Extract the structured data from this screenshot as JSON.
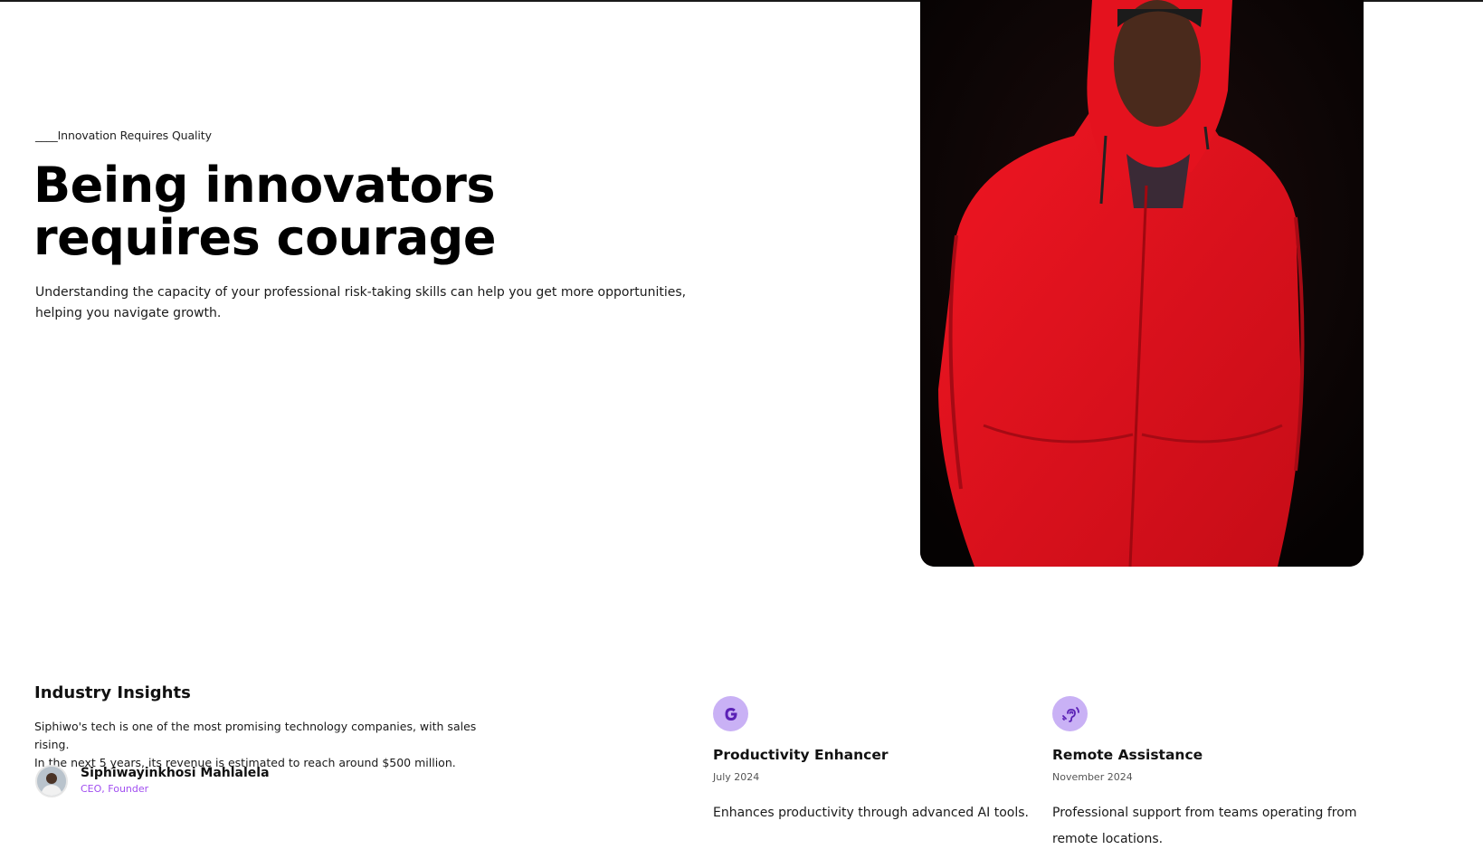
{
  "hero": {
    "eyebrow": "____Innovation Requires Quality",
    "headline": "Being innovators requires courage",
    "lead": "Understanding the capacity of your professional risk-taking skills can help you get more opportunities, helping you navigate growth."
  },
  "insights": {
    "title": "Industry Insights",
    "text_line1": "Siphiwo's tech is one of the most promising technology companies, with sales rising.",
    "text_line2": "In the next 5 years, its revenue is estimated to reach around $500 million.",
    "author_name": "Siphiwayinkhosi Mahlalela",
    "author_role": "CEO, Founder"
  },
  "cards": [
    {
      "icon": "google-g-icon",
      "title": "Productivity Enhancer",
      "date": "July 2024",
      "description": "Enhances productivity through advanced AI tools."
    },
    {
      "icon": "assistive-listening-icon",
      "title": "Remote Assistance",
      "date": "November 2024",
      "description": "Professional support from teams operating from remote locations."
    }
  ],
  "colors": {
    "accent": "#a14ef0",
    "icon_bg": "#c9b1f5",
    "icon_fg": "#5b21b6",
    "hoodie": "#e0101c"
  }
}
